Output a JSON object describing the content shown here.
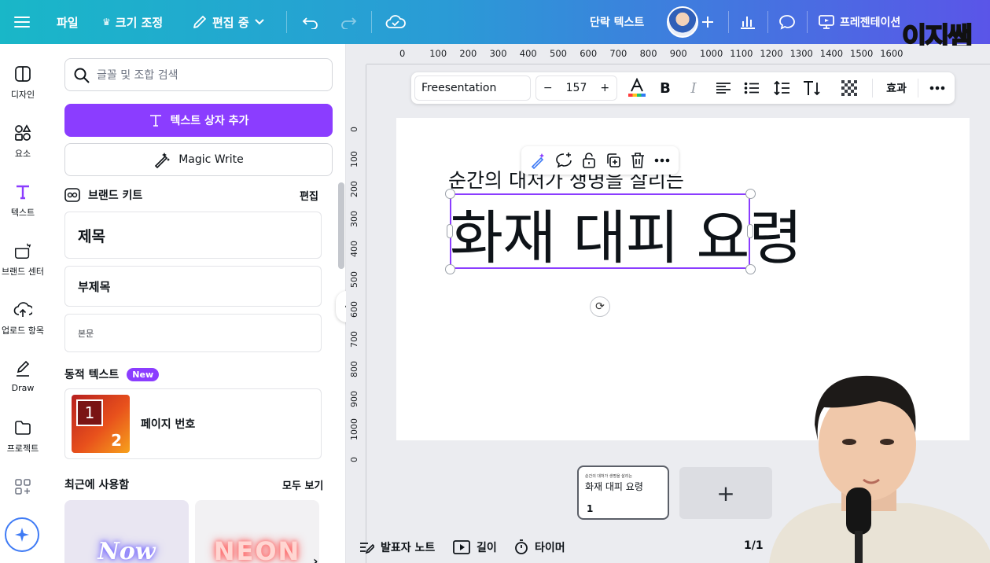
{
  "topbar": {
    "file_label": "파일",
    "resize_label": "크기 조정",
    "editing_label": "편집 중",
    "element_type": "단락 텍스트",
    "present_label": "프레젠테이션",
    "watermark": "이지쌤"
  },
  "rail": {
    "items": [
      {
        "label": "디자인"
      },
      {
        "label": "요소"
      },
      {
        "label": "텍스트"
      },
      {
        "label": "브랜드 센터"
      },
      {
        "label": "업로드 항목"
      },
      {
        "label": "Draw"
      },
      {
        "label": "프로젝트"
      }
    ]
  },
  "panel": {
    "search_placeholder": "글꼴 및 조합 검색",
    "add_textbox": "텍스트 상자 추가",
    "magic_write": "Magic Write",
    "brand_kit": "브랜드 키트",
    "brand_edit": "편집",
    "heading": "제목",
    "subheading": "부제목",
    "body": "본문",
    "dynamic_text": "동적 텍스트",
    "new_badge": "New",
    "page_number": "페이지 번호",
    "page_number_icon_top": "1",
    "page_number_icon_bottom": "2",
    "recent": "최근에 사용함",
    "see_all": "모두 보기",
    "recent_items": [
      "Now",
      "NEON"
    ]
  },
  "ruler": {
    "top": [
      "0",
      "100",
      "200",
      "300",
      "400",
      "500",
      "600",
      "700",
      "800",
      "900",
      "1000",
      "1100",
      "1200",
      "1300",
      "1400",
      "1500",
      "1600"
    ],
    "left": [
      "0",
      "100",
      "200",
      "300",
      "400",
      "500",
      "600",
      "700",
      "800",
      "900",
      "1000",
      "0"
    ]
  },
  "format_toolbar": {
    "font": "Freesentation",
    "size": "157",
    "minus": "−",
    "plus": "+",
    "effects": "효과"
  },
  "canvas": {
    "subtitle": "순간의 대처가 생명을 살리는",
    "title": "화재 대피 요령"
  },
  "pages": {
    "thumb_subtitle": "순간의 대처가 생명을 살리는",
    "thumb_title": "화재 대피 요령",
    "thumb_number": "1",
    "add": "+",
    "counter": "1/1"
  },
  "footer": {
    "notes": "발표자 노트",
    "duration": "길이",
    "timer": "타이머"
  },
  "colors": {
    "accent": "#8b3dff",
    "topbar_start": "#19b7c8",
    "topbar_end": "#5a55e8"
  }
}
